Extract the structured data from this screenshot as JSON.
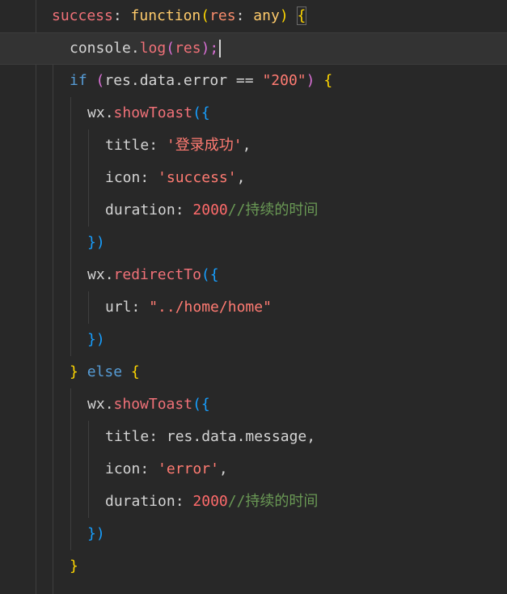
{
  "editor": {
    "lines": [
      {
        "tokens": [
          "success",
          ": ",
          "function",
          "(",
          "res",
          ": ",
          "any",
          ") ",
          "{"
        ]
      },
      {
        "tokens": [
          "console",
          ".",
          "log",
          "(",
          "res",
          ");"
        ]
      },
      {
        "tokens": [
          "if",
          " (",
          "res.data.error",
          " == ",
          "\"200\"",
          ") ",
          "{"
        ]
      },
      {
        "tokens": [
          "wx",
          ".",
          "showToast",
          "(",
          "{"
        ]
      },
      {
        "tokens": [
          "title",
          ": ",
          "'登录成功'",
          ","
        ]
      },
      {
        "tokens": [
          "icon",
          ": ",
          "'success'",
          ","
        ]
      },
      {
        "tokens": [
          "duration",
          ": ",
          "2000",
          "//持续的时间"
        ]
      },
      {
        "tokens": [
          "}",
          ")"
        ]
      },
      {
        "tokens": [
          "wx",
          ".",
          "redirectTo",
          "(",
          "{"
        ]
      },
      {
        "tokens": [
          "url",
          ": ",
          "\"../home/home\""
        ]
      },
      {
        "tokens": [
          "}",
          ")"
        ]
      },
      {
        "tokens": [
          "}",
          " ",
          "else",
          " ",
          "{"
        ]
      },
      {
        "tokens": [
          "wx",
          ".",
          "showToast",
          "(",
          "{"
        ]
      },
      {
        "tokens": [
          "title",
          ": ",
          "res.data.message",
          ","
        ]
      },
      {
        "tokens": [
          "icon",
          ": ",
          "'error'",
          ","
        ]
      },
      {
        "tokens": [
          "duration",
          ": ",
          "2000",
          "//持续的时间"
        ]
      },
      {
        "tokens": [
          "}",
          ")"
        ]
      },
      {
        "tokens": [
          "}"
        ]
      }
    ]
  },
  "colors": {
    "background": "#282828",
    "current_line": "#333333",
    "indent_guide": "#3e3e3e"
  }
}
